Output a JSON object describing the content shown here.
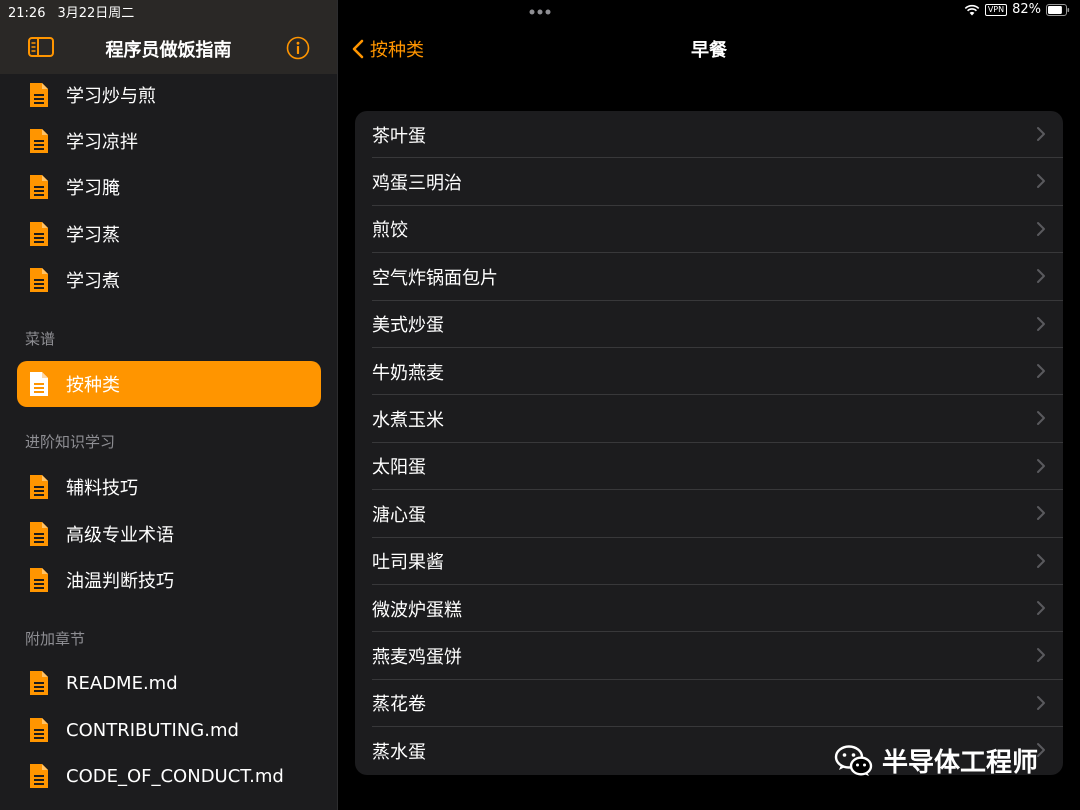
{
  "status": {
    "time": "21:26",
    "date": "3月22日周二",
    "vpn": "VPN",
    "battery": "82%",
    "battery_level": 0.82
  },
  "sidebar": {
    "title": "程序员做饭指南",
    "items_top": [
      {
        "label": "学习炒与煎"
      },
      {
        "label": "学习凉拌"
      },
      {
        "label": "学习腌"
      },
      {
        "label": "学习蒸"
      },
      {
        "label": "学习煮"
      }
    ],
    "section_recipes": "菜谱",
    "recipes_item": {
      "label": "按种类"
    },
    "section_advanced": "进阶知识学习",
    "advanced_items": [
      {
        "label": "辅料技巧"
      },
      {
        "label": "高级专业术语"
      },
      {
        "label": "油温判断技巧"
      }
    ],
    "section_appendix": "附加章节",
    "appendix_items": [
      {
        "label": "README.md"
      },
      {
        "label": "CONTRIBUTING.md"
      },
      {
        "label": "CODE_OF_CONDUCT.md"
      }
    ]
  },
  "main": {
    "back_label": "按种类",
    "title": "早餐",
    "items": [
      "茶叶蛋",
      "鸡蛋三明治",
      "煎饺",
      "空气炸锅面包片",
      "美式炒蛋",
      "牛奶燕麦",
      "水煮玉米",
      "太阳蛋",
      "溏心蛋",
      "吐司果酱",
      "微波炉蛋糕",
      "燕麦鸡蛋饼",
      "蒸花卷",
      "蒸水蛋"
    ]
  },
  "watermark": {
    "text": "半导体工程师"
  },
  "colors": {
    "accent": "#ff9500",
    "sidebar_bg": "#1c1c1e",
    "list_bg": "#1c1c1e"
  }
}
